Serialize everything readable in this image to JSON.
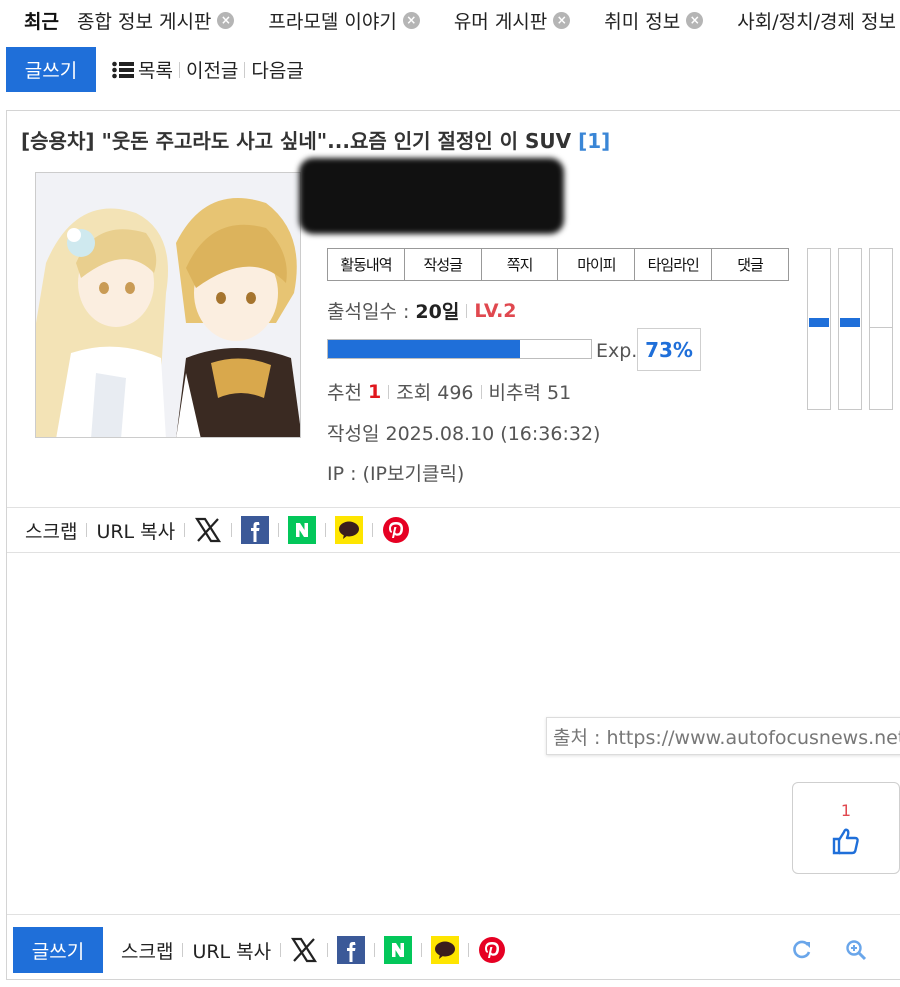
{
  "recent": {
    "label": "최근",
    "tabs": [
      {
        "label": "종합 정보 게시판"
      },
      {
        "label": "프라모델 이야기"
      },
      {
        "label": "유머 게시판"
      },
      {
        "label": "취미 정보"
      },
      {
        "label": "사회/정치/경제 정보"
      }
    ],
    "close_glyph": "×"
  },
  "toolbar": {
    "write_label": "글쓰기",
    "list_label": "목록",
    "prev_label": "이전글",
    "next_label": "다음글"
  },
  "post": {
    "category": "[승용차]",
    "title": "\"웃돈 주고라도 사고 싶네\"...요즘 인기 절정인 이 SUV",
    "comment_count": "[1]",
    "profile_menu": [
      "활동내역",
      "작성글",
      "쪽지",
      "마이피",
      "타임라인",
      "댓글"
    ],
    "attendance_label": "출석일수 :",
    "attendance_value": "20일",
    "level": "LV.2",
    "exp_label": "Exp.",
    "exp_percent": "73%",
    "exp_fraction": 0.73,
    "recommend_label": "추천",
    "recommend_value": "1",
    "views_label": "조회 496",
    "ratio_label": "비추력 51",
    "date_label": "작성일 2025.08.10 (16:36:32)",
    "ip_label": "IP : (IP보기클릭)",
    "source_text": "출처 : https://www.autofocusnews.net"
  },
  "share": {
    "scrap_label": "스크랩",
    "url_copy_label": "URL 복사"
  },
  "like": {
    "count": "1"
  },
  "colors": {
    "accent": "#1f6fd9",
    "level": "#e0484f",
    "comment_count": "#3a86d6",
    "naver": "#03c75a",
    "kakao": "#fee500",
    "facebook": "#3b5998",
    "pinterest": "#e60023"
  },
  "icons": [
    "list-icon",
    "x-twitter-icon",
    "facebook-icon",
    "naver-icon",
    "kakao-icon",
    "pinterest-icon",
    "refresh-icon",
    "zoom-in-icon",
    "thumbs-up-icon"
  ]
}
